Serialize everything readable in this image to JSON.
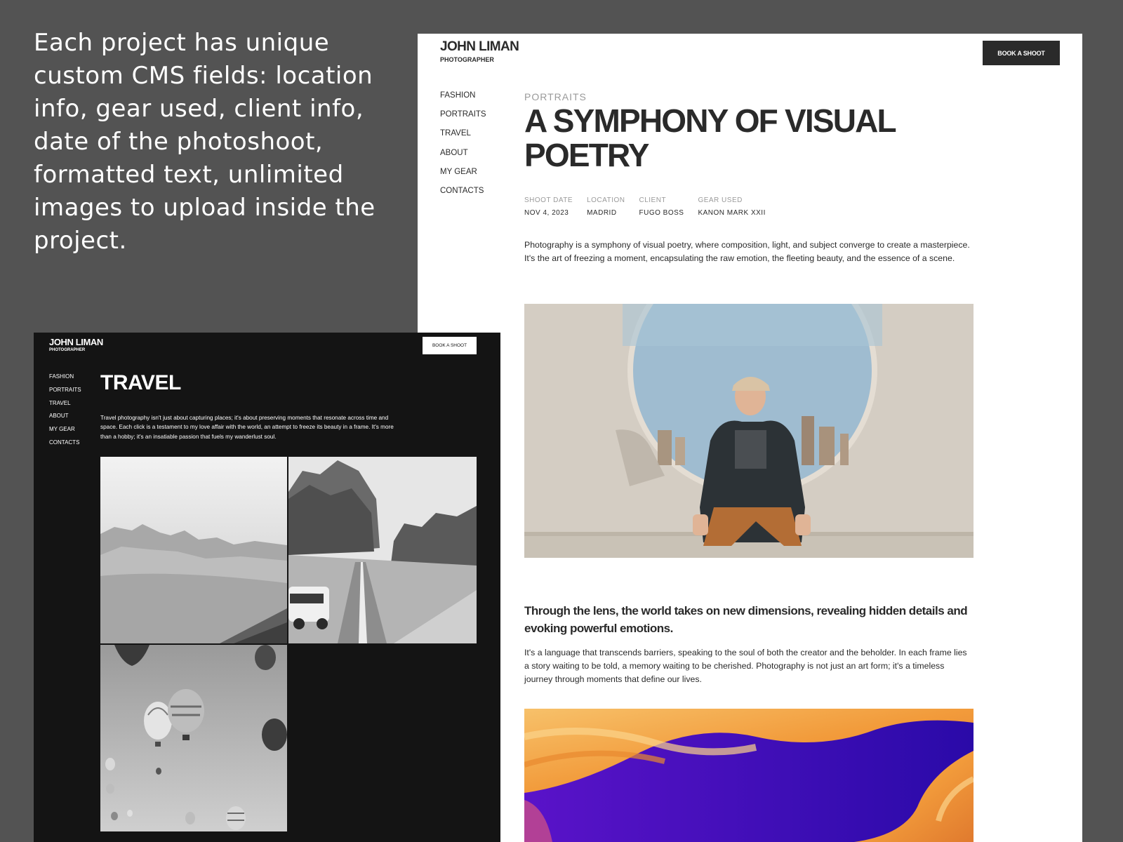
{
  "caption": "Each project has unique custom CMS fields: location info, gear used, client info, date of the photoshoot, formatted text, unlimited images to upload inside the project.",
  "light_page": {
    "logo_name": "JOHN LIMAN",
    "logo_sub": "PHOTOGRAPHER",
    "book_button": "BOOK A SHOOT",
    "nav": [
      "FASHION",
      "PORTRAITS",
      "TRAVEL",
      "ABOUT",
      "MY GEAR",
      "CONTACTS"
    ],
    "category": "PORTRAITS",
    "title": "A SYMPHONY OF VISUAL POETRY",
    "meta": [
      {
        "label": "SHOOT DATE",
        "value": "NOV 4, 2023"
      },
      {
        "label": "LOCATION",
        "value": "MADRID"
      },
      {
        "label": "CLIENT",
        "value": "FUGO BOSS"
      },
      {
        "label": "GEAR USED",
        "value": "KANON MARK XXII"
      }
    ],
    "paragraph": "Photography is a symphony of visual poetry, where composition, light, and subject converge to create a masterpiece. It's the art of freezing a moment, encapsulating the raw emotion, the fleeting beauty, and the essence of a scene.",
    "subheading": "Through the lens, the world takes on new dimensions, revealing hidden details and evoking powerful emotions.",
    "paragraph2": "It's a language that transcends barriers, speaking to the soul of both the creator and the beholder. In each frame lies a story waiting to be told, a memory waiting to be cherished. Photography is not just an art form; it's a timeless journey through moments that define our lives."
  },
  "dark_page": {
    "logo_name": "JOHN LIMAN",
    "logo_sub": "PHOTOGRAPHER",
    "book_button": "BOOK A SHOOT",
    "nav": [
      "FASHION",
      "PORTRAITS",
      "TRAVEL",
      "ABOUT",
      "MY GEAR",
      "CONTACTS"
    ],
    "title": "TRAVEL",
    "paragraph": "Travel photography isn't just about capturing places; it's about preserving moments that resonate across time and space. Each click is a testament to my love affair with the world, an attempt to freeze its beauty in a frame. It's more than a hobby; it's an insatiable passion that fuels my wanderlust soul."
  },
  "colors": {
    "background": "#535353",
    "dark_page": "#141414",
    "text_dark": "#2a2a2a",
    "muted": "#9a9a9a"
  }
}
